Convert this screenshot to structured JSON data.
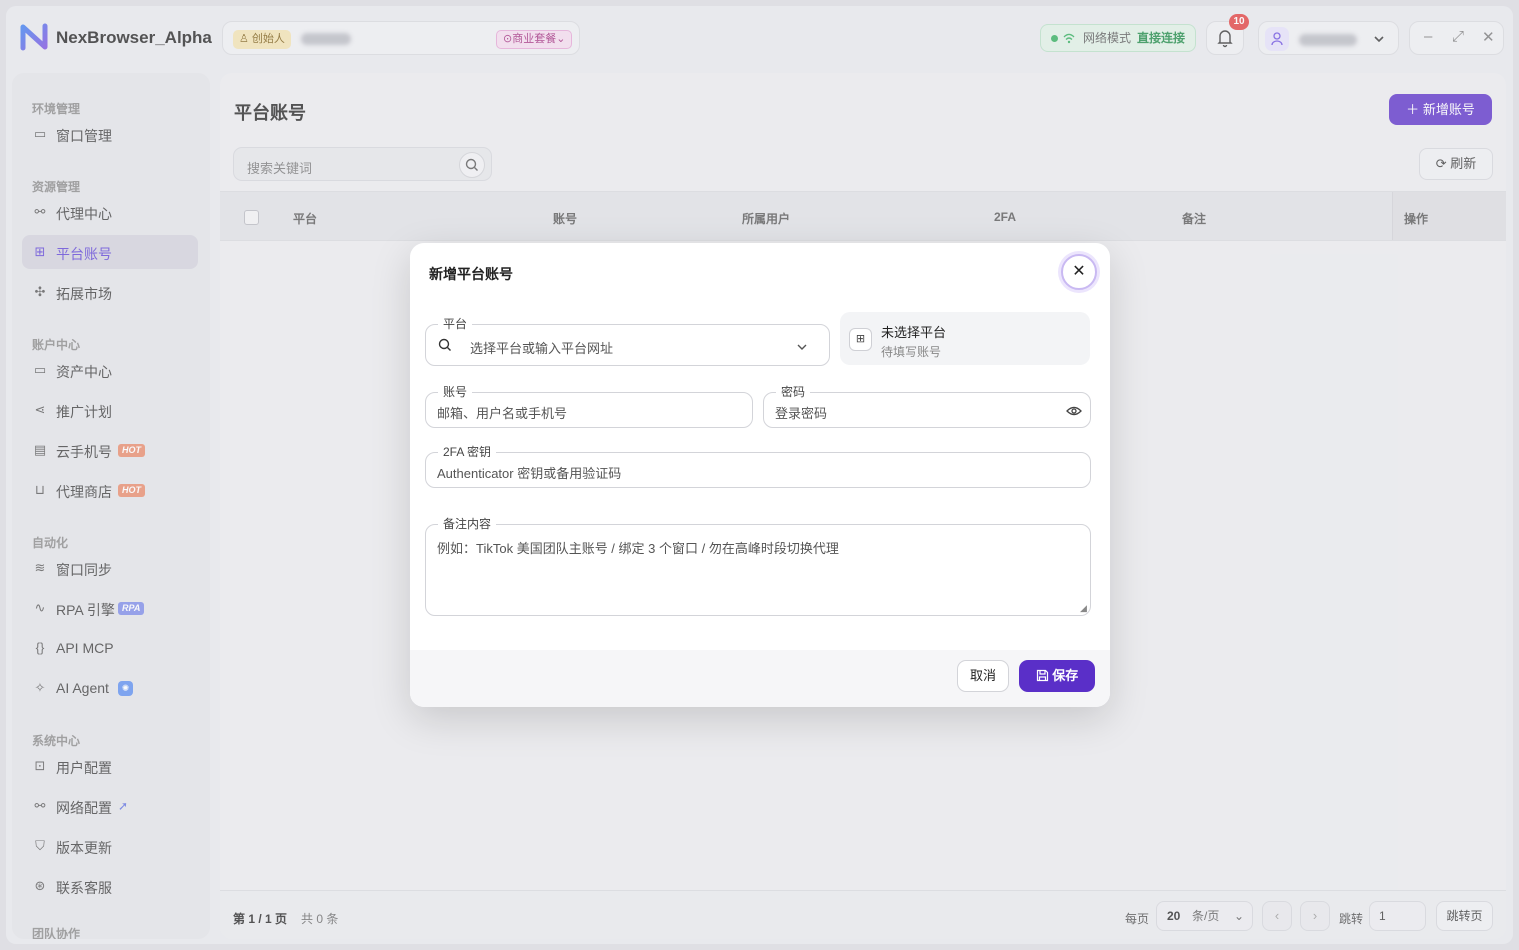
{
  "app": {
    "name": "NexBrowser_Alpha"
  },
  "header": {
    "founder_badge": "创始人",
    "plan_badge": "商业套餐",
    "network_label": "网络模式",
    "network_value": "直接连接",
    "notification_count": "10"
  },
  "sidebar": {
    "sections": [
      "环境管理",
      "资源管理",
      "账户中心",
      "自动化",
      "系统中心",
      "团队协作"
    ],
    "items": [
      {
        "label": "窗口管理"
      },
      {
        "label": "代理中心"
      },
      {
        "label": "平台账号"
      },
      {
        "label": "拓展市场"
      },
      {
        "label": "资产中心"
      },
      {
        "label": "推广计划"
      },
      {
        "label": "云手机号",
        "tag": "HOT"
      },
      {
        "label": "代理商店",
        "tag": "HOT"
      },
      {
        "label": "窗口同步"
      },
      {
        "label": "RPA 引擎",
        "tag": "RPA"
      },
      {
        "label": "API MCP"
      },
      {
        "label": "AI Agent"
      },
      {
        "label": "用户配置"
      },
      {
        "label": "网络配置"
      },
      {
        "label": "版本更新"
      },
      {
        "label": "联系客服"
      }
    ]
  },
  "main": {
    "title": "平台账号",
    "add_button": "新增账号",
    "search_placeholder": "搜索关键词",
    "refresh_button": "刷新",
    "columns": [
      "平台",
      "账号",
      "所属用户",
      "2FA",
      "备注",
      "操作"
    ],
    "footer": {
      "page": "第 1 / 1 页",
      "total": "共 0 条",
      "per_page_label": "每页",
      "per_page_value": "20",
      "per_page_unit": "条/页",
      "jump_label": "跳转",
      "jump_value": "1",
      "jump_button": "跳转页"
    }
  },
  "modal": {
    "title": "新增平台账号",
    "platform": {
      "label": "平台",
      "placeholder": "选择平台或输入平台网址"
    },
    "platform_info": {
      "title": "未选择平台",
      "subtitle": "待填写账号"
    },
    "account": {
      "label": "账号",
      "placeholder": "邮箱、用户名或手机号"
    },
    "password": {
      "label": "密码",
      "placeholder": "登录密码"
    },
    "twofa": {
      "label": "2FA 密钥",
      "placeholder": "Authenticator 密钥或备用验证码"
    },
    "note": {
      "label": "备注内容",
      "placeholder": "例如：TikTok 美国团队主账号 / 绑定 3 个窗口 / 勿在高峰时段切换代理"
    },
    "cancel": "取消",
    "save": "保存"
  },
  "colors": {
    "accent": "#5a2fc8",
    "hot": "#e98a6a",
    "online": "#2eae5a"
  }
}
